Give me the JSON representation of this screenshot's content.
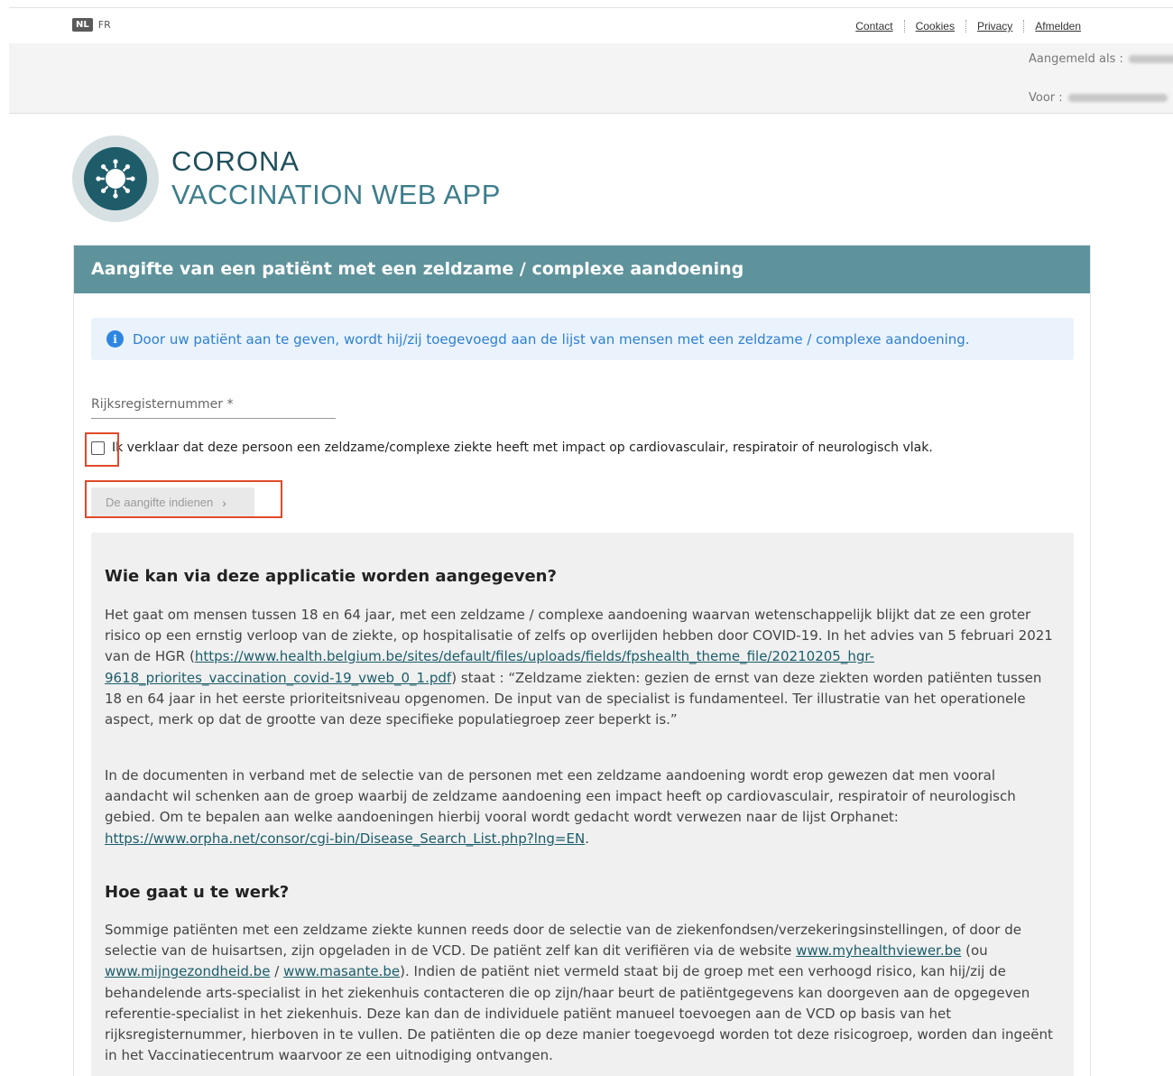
{
  "topbar": {
    "lang_nl": "NL",
    "lang_fr": "FR",
    "links": [
      "Contact",
      "Cookies",
      "Privacy",
      "Afmelden"
    ]
  },
  "userbar": {
    "logged_in_label": "Aangemeld als :",
    "for_label": "Voor :"
  },
  "app": {
    "title_line1": "CORONA",
    "title_line2": "VACCINATION WEB APP"
  },
  "card": {
    "heading": "Aangifte van een patiënt met een zeldzame / complexe aandoening",
    "info_icon": "i",
    "info_text": "Door uw patiënt aan te geven, wordt hij/zij toegevoegd aan de lijst van mensen met een zeldzame / complexe aandoening.",
    "rrn_label": "Rijksregisternummer *",
    "checkbox_label": "Ik verklaar dat deze persoon een zeldzame/complexe ziekte heeft met impact op cardiovasculair, respiratoir of neurologisch vlak.",
    "submit_label": "De aangifte indienen",
    "submit_chevron": "›"
  },
  "panel": {
    "h1": "Wie kan via deze applicatie worden aangegeven?",
    "p1_a": "Het gaat om mensen tussen 18 en 64 jaar, met een zeldzame / complexe aandoening waarvan wetenschappelijk blijkt dat ze een groter risico op een ernstig verloop van de ziekte, op hospitalisatie of zelfs op overlijden hebben door COVID-19. In het advies van 5 februari 2021 van de HGR (",
    "p1_link": "https://www.health.belgium.be/sites/default/files/uploads/fields/fpshealth_theme_file/20210205_hgr-9618_priorites_vaccination_covid-19_vweb_0_1.pdf",
    "p1_b": ") staat : “Zeldzame ziekten: gezien de ernst van deze ziekten worden patiënten tussen 18 en 64 jaar in het eerste prioriteitsniveau opgenomen. De input van de specialist is fundamenteel. Ter illustratie van het operationele aspect, merk op dat de grootte van deze specifieke populatiegroep zeer beperkt is.”",
    "p2_a": "In de documenten in verband met de selectie van de personen met een zeldzame aandoening wordt erop gewezen dat men vooral aandacht wil schenken aan de groep waarbij de zeldzame aandoening een impact heeft op cardiovasculair, respiratoir of neurologisch gebied. Om te bepalen aan welke aandoeningen hierbij vooral wordt gedacht wordt verwezen naar de lijst Orphanet: ",
    "p2_link": "https://www.orpha.net/consor/cgi-bin/Disease_Search_List.php?lng=EN",
    "p2_b": ".",
    "h2": "Hoe gaat u te werk?",
    "p3_a": "Sommige patiënten met een zeldzame ziekte kunnen reeds door de selectie van de ziekenfondsen/verzekeringsinstellingen, of door de selectie van de huisartsen, zijn opgeladen in de VCD. De patiënt zelf kan dit verifiëren via de website ",
    "p3_link1": "www.myhealthviewer.be",
    "p3_b": " (ou ",
    "p3_link2": "www.mijngezondheid.be",
    "p3_c": " / ",
    "p3_link3": "www.masante.be",
    "p3_d": "). Indien de patiënt niet vermeld staat bij de groep met een verhoogd risico, kan hij/zij de behandelende arts-specialist in het ziekenhuis contacteren die op zijn/haar beurt de patiëntgegevens kan doorgeven aan de opgegeven referentie-specialist in het ziekenhuis. Deze kan dan de individuele patiënt manueel toevoegen aan de VCD op basis van het rijksregisternummer, hierboven in te vullen. De patiënten die op deze manier toegevoegd worden tot deze risicogroep, worden dan ingeënt in het Vaccinatiecentrum waarvoor ze een uitnodiging ontvangen."
  },
  "colors": {
    "header_bg": "#5f939c",
    "brand_dark": "#1f5c6a",
    "info_blue": "#2d7fd2",
    "highlight": "#e04a2a"
  }
}
